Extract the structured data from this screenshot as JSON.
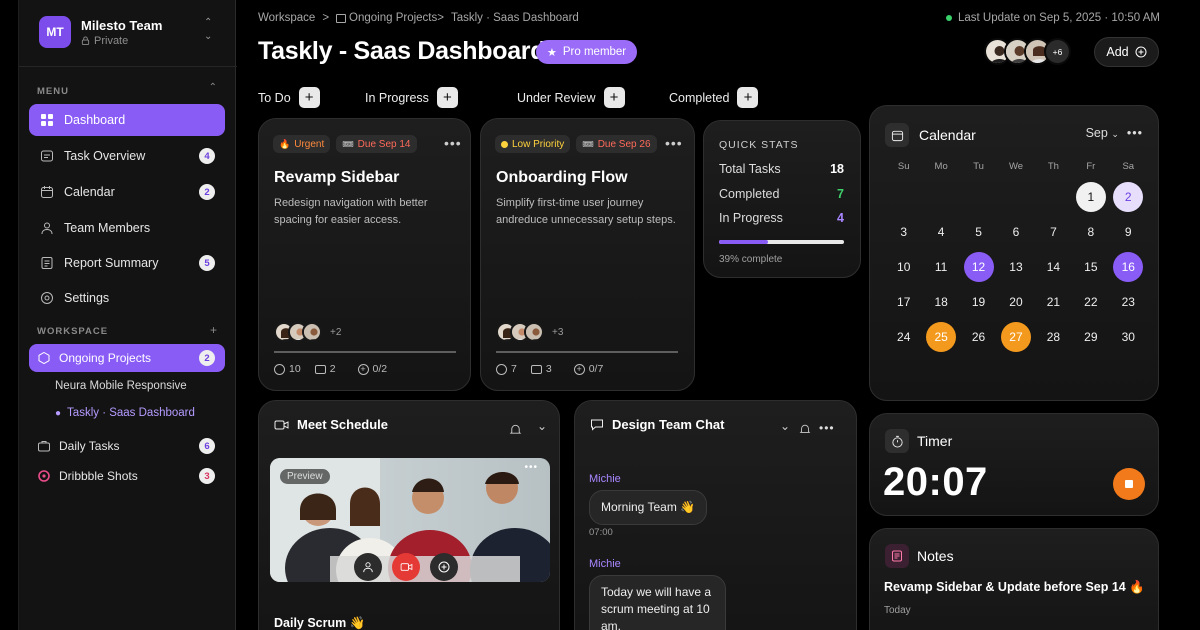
{
  "sidebar": {
    "team": {
      "initials": "MT",
      "name": "Milesto Team",
      "visibility": "Private"
    },
    "menu_label": "MENU",
    "menu": [
      {
        "label": "Dashboard",
        "icon": "grid-icon",
        "active": true
      },
      {
        "label": "Task Overview",
        "icon": "list-icon",
        "badge": "4"
      },
      {
        "label": "Calendar",
        "icon": "calendar-icon",
        "badge": "2"
      },
      {
        "label": "Team Members",
        "icon": "user-icon"
      },
      {
        "label": "Report Summary",
        "icon": "report-icon",
        "badge": "5"
      },
      {
        "label": "Settings",
        "icon": "gear-icon"
      }
    ],
    "workspace_label": "WORKSPACE",
    "workspace": {
      "ongoing": {
        "label": "Ongoing Projects",
        "badge": "2"
      },
      "sub_items": [
        "Neura Mobile Responsive",
        "Taskly · Saas Dashboard"
      ],
      "daily": {
        "label": "Daily Tasks",
        "badge": "6"
      },
      "dribbble": {
        "label": "Dribbble Shots",
        "badge": "3"
      }
    }
  },
  "header": {
    "breadcrumb": [
      "Workspace",
      ">",
      "Ongoing Projects>",
      "Taskly · Saas Dashboard"
    ],
    "last_update": "Last Update on Sep 5, 2025 · 10:50 AM",
    "title": "Taskly - Saas Dashboard",
    "pro_badge": "Pro member",
    "avatar_more": "+6",
    "add_label": "Add"
  },
  "columns": [
    "To Do",
    "In Progress",
    "Under Review",
    "Completed"
  ],
  "cards": [
    {
      "tag1": "Urgent",
      "tag2": "Due Sep 14",
      "title": "Revamp Sidebar",
      "desc": "Redesign navigation with better spacing for easier access.",
      "more": "+2",
      "time": "10",
      "files": "2",
      "tasks": "0/2"
    },
    {
      "tag1": "Low Priority",
      "tag2": "Due Sep 26",
      "title": "Onboarding Flow",
      "desc": "Simplify first-time user journey andreduce unnecessary setup steps.",
      "more": "+3",
      "time": "7",
      "files": "3",
      "tasks": "0/7"
    }
  ],
  "quick_stats": {
    "title": "QUICK STATS",
    "rows": [
      {
        "label": "Total Tasks",
        "value": "18"
      },
      {
        "label": "Completed",
        "value": "7"
      },
      {
        "label": "In Progress",
        "value": "4"
      }
    ],
    "progress_fraction": 0.39,
    "footer": "39% complete",
    "colors": {
      "completed": "#3fd06b",
      "in_progress": "#a886ff"
    }
  },
  "calendar": {
    "title": "Calendar",
    "month": "Sep",
    "weekdays": [
      "Su",
      "Mo",
      "Tu",
      "We",
      "Th",
      "Fr",
      "Sa"
    ],
    "days": [
      "",
      "",
      "",
      "",
      "",
      "1",
      "2",
      "3",
      "4",
      "5",
      "6",
      "7",
      "8",
      "9",
      "10",
      "11",
      "12",
      "13",
      "14",
      "15",
      "16",
      "17",
      "18",
      "19",
      "20",
      "21",
      "22",
      "23",
      "24",
      "25",
      "26",
      "27",
      "28",
      "29",
      "30"
    ],
    "highlights": {
      "1": "white",
      "2": "lilac",
      "12": "purple",
      "16": "purple",
      "25": "orange",
      "27": "orange"
    }
  },
  "meet": {
    "title": "Meet Schedule",
    "preview": "Preview",
    "event": "Daily Scrum 👋"
  },
  "chat": {
    "title": "Design Team Chat",
    "messages": [
      {
        "sender": "Michie",
        "text": "Morning Team 👋",
        "time": "07:00"
      },
      {
        "sender": "Michie",
        "text": "Today we will have a scrum meeting at 10 am."
      }
    ]
  },
  "timer": {
    "title": "Timer",
    "value": "20:07"
  },
  "notes": {
    "title": "Notes",
    "text": "Revamp Sidebar & Update before Sep 14 🔥",
    "date": "Today"
  },
  "colors": {
    "accent": "#8a5cf6",
    "orange": "#f27a1a",
    "urgent": "#ff8a3d",
    "low_priority": "#ffd23d",
    "due": "#ff6a5a"
  }
}
